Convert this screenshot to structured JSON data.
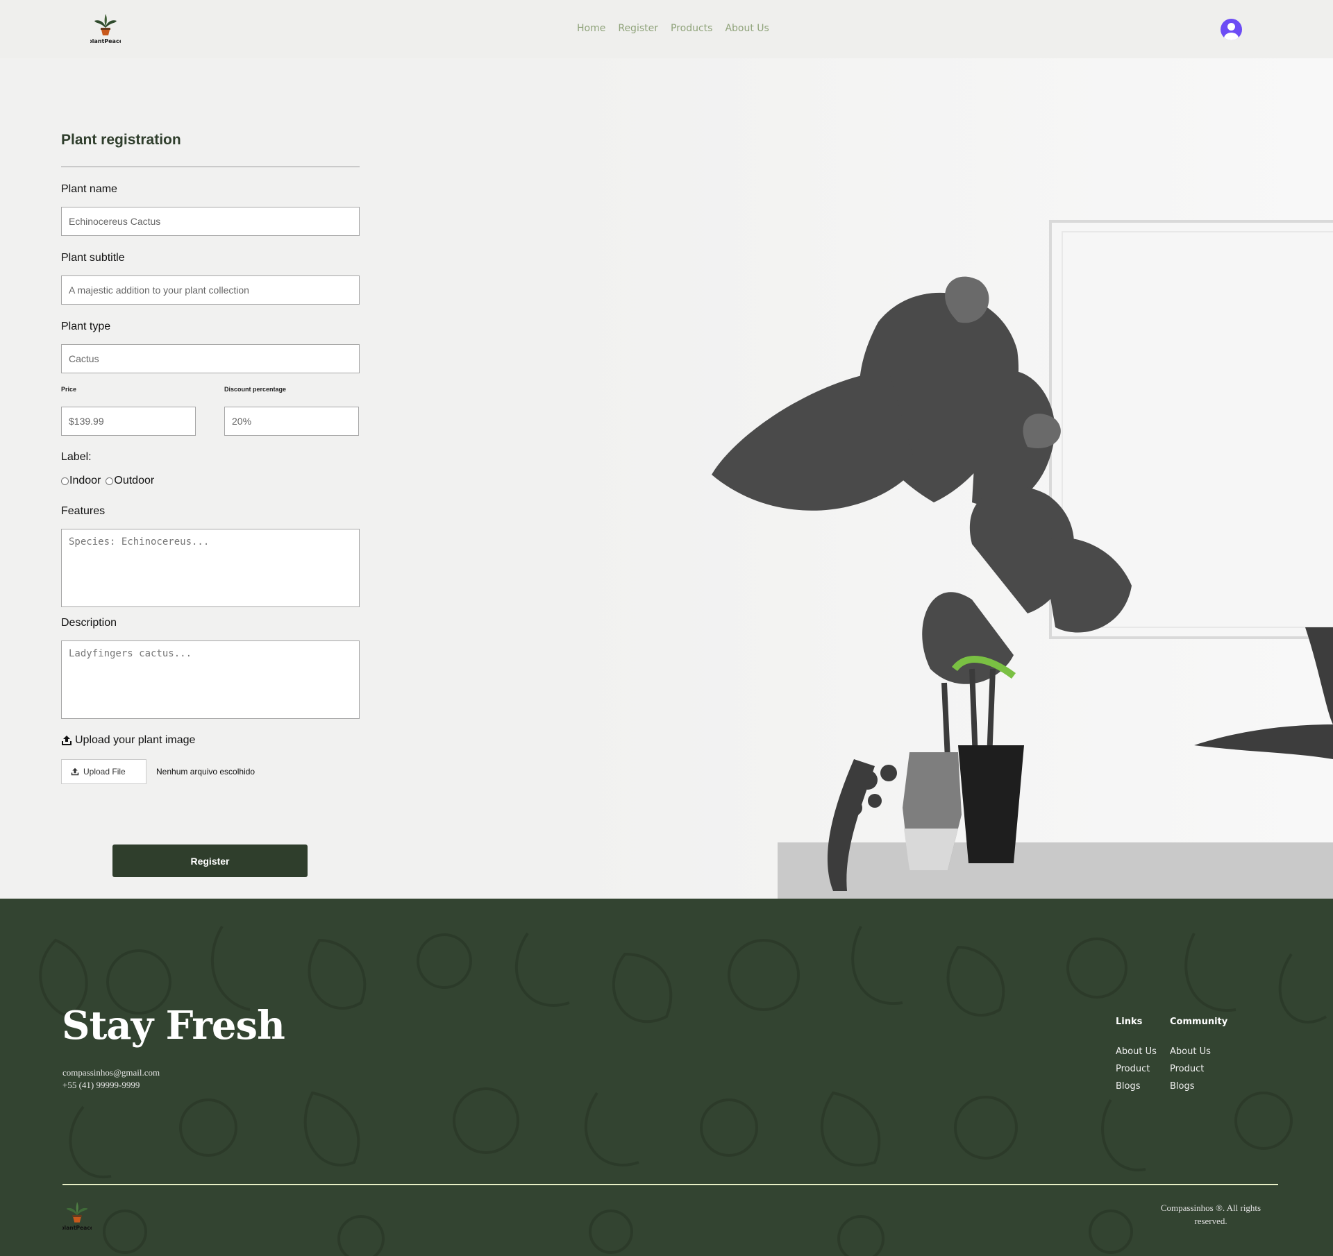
{
  "header": {
    "logo_text": "plantPeace",
    "nav": [
      "Home",
      "Register",
      "Products",
      "About Us"
    ]
  },
  "form": {
    "title": "Plant registration",
    "plant_name_label": "Plant name",
    "plant_name_placeholder": "Echinocereus Cactus",
    "plant_subtitle_label": "Plant subtitle",
    "plant_subtitle_placeholder": "A majestic addition to your plant collection",
    "plant_type_label": "Plant type",
    "plant_type_placeholder": "Cactus",
    "price_label": "Price",
    "price_placeholder": "$139.99",
    "discount_label": "Discount percentage",
    "discount_placeholder": "20%",
    "label_heading": "Label:",
    "label_options": [
      "Indoor",
      "Outdoor"
    ],
    "features_label": "Features",
    "features_placeholder": "Species: Echinocereus...",
    "description_label": "Description",
    "description_placeholder": "Ladyfingers cactus...",
    "upload_title": "Upload your plant image",
    "upload_button": "Upload File",
    "no_file_text": "Nenhum arquivo escolhido",
    "register_button": "Register"
  },
  "footer": {
    "headline": "Stay Fresh",
    "email": "compassinhos@gmail.com",
    "phone": "+55 (41) 99999-9999",
    "links_title": "Links",
    "links": [
      "About Us",
      "Product",
      "Blogs"
    ],
    "community_title": "Community",
    "community": [
      "About Us",
      "Product",
      "Blogs"
    ],
    "logo_text": "plantPeace",
    "copyright": "Compassinhos ®. All rights reserved."
  },
  "colors": {
    "brand_dark_green": "#2f3e2c",
    "footer_bg": "#334431",
    "nav_link": "#8fa37a",
    "avatar": "#6c4cf5"
  }
}
